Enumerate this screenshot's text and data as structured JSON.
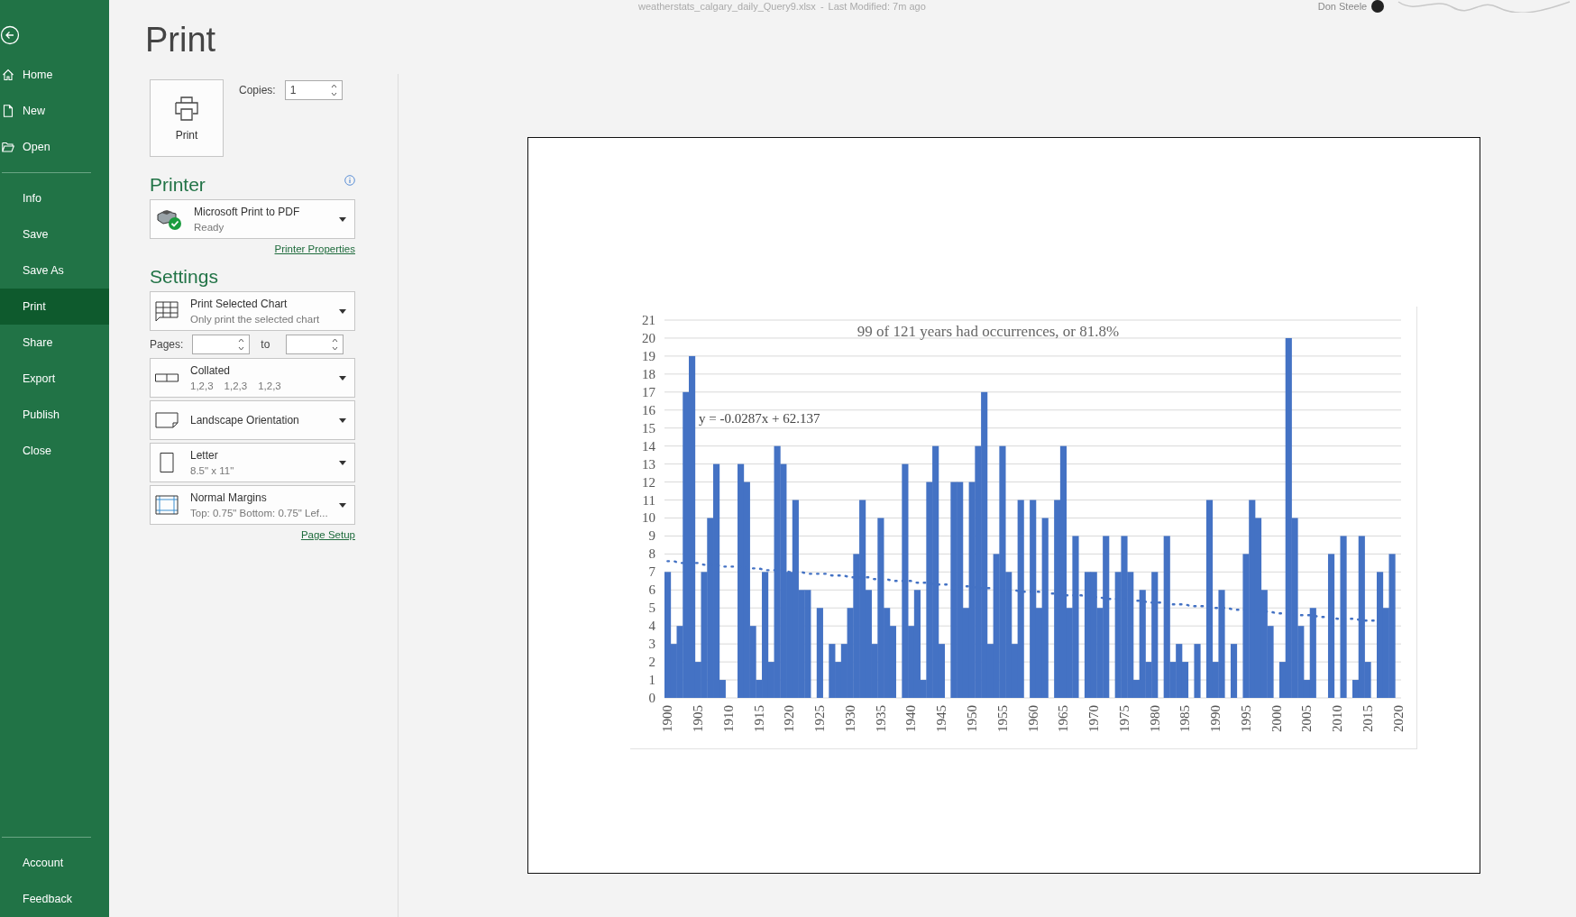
{
  "title_bar": {
    "file": "weatherstats_calgary_daily_Query9.xlsx",
    "separator": "-",
    "modified": "Last Modified: 7m ago",
    "user": "Don Steele"
  },
  "sidebar": {
    "top_items": [
      {
        "label": "Home",
        "kind": "home",
        "selected": false
      },
      {
        "label": "New",
        "kind": "new",
        "selected": false
      },
      {
        "label": "Open",
        "kind": "open",
        "selected": false
      }
    ],
    "items": [
      {
        "label": "Info",
        "selected": false
      },
      {
        "label": "Save",
        "selected": false
      },
      {
        "label": "Save As",
        "selected": false
      },
      {
        "label": "Print",
        "selected": true
      },
      {
        "label": "Share",
        "selected": false
      },
      {
        "label": "Export",
        "selected": false
      },
      {
        "label": "Publish",
        "selected": false
      },
      {
        "label": "Close",
        "selected": false
      }
    ],
    "bottom_items": [
      {
        "label": "Account",
        "selected": false
      },
      {
        "label": "Feedback",
        "selected": false
      }
    ]
  },
  "heading": "Print",
  "print_button": "Print",
  "copies": {
    "label": "Copies:",
    "value": "1"
  },
  "printer": {
    "heading": "Printer",
    "name": "Microsoft Print to PDF",
    "status": "Ready",
    "properties_link": "Printer Properties"
  },
  "settings": {
    "heading": "Settings",
    "scope": {
      "kind": "selection",
      "title": "Print Selected Chart",
      "subtitle": "Only print the selected chart"
    },
    "pages": {
      "label": "Pages:",
      "to_label": "to"
    },
    "options": [
      {
        "kind": "collate",
        "title": "Collated",
        "subtitle": [
          "1,2,3",
          "1,2,3",
          "1,2,3"
        ]
      },
      {
        "kind": "orientation",
        "title": "Landscape Orientation"
      },
      {
        "kind": "paper",
        "title": "Letter",
        "subtitle": [
          "8.5\" x 11\""
        ]
      },
      {
        "kind": "margins",
        "title": "Normal Margins",
        "subtitle": [
          "Top: 0.75\" Bottom: 0.75\" Lef..."
        ]
      }
    ],
    "page_setup_link": "Page Setup"
  },
  "preview": {
    "chart_data": {
      "type": "bar",
      "title": "99 of 121 years had occurrences, or 81.8%",
      "x": [
        1900,
        1901,
        1902,
        1903,
        1904,
        1905,
        1906,
        1907,
        1908,
        1909,
        1910,
        1911,
        1912,
        1913,
        1914,
        1915,
        1916,
        1917,
        1918,
        1919,
        1920,
        1921,
        1922,
        1923,
        1924,
        1925,
        1926,
        1927,
        1928,
        1929,
        1930,
        1931,
        1932,
        1933,
        1934,
        1935,
        1936,
        1937,
        1938,
        1939,
        1940,
        1941,
        1942,
        1943,
        1944,
        1945,
        1946,
        1947,
        1948,
        1949,
        1950,
        1951,
        1952,
        1953,
        1954,
        1955,
        1956,
        1957,
        1958,
        1959,
        1960,
        1961,
        1962,
        1963,
        1964,
        1965,
        1966,
        1967,
        1968,
        1969,
        1970,
        1971,
        1972,
        1973,
        1974,
        1975,
        1976,
        1977,
        1978,
        1979,
        1980,
        1981,
        1982,
        1983,
        1984,
        1985,
        1986,
        1987,
        1988,
        1989,
        1990,
        1991,
        1992,
        1993,
        1994,
        1995,
        1996,
        1997,
        1998,
        1999,
        2000,
        2001,
        2002,
        2003,
        2004,
        2005,
        2006,
        2007,
        2008,
        2009,
        2010,
        2011,
        2012,
        2013,
        2014,
        2015,
        2016,
        2017,
        2018,
        2019,
        2020
      ],
      "series": [
        {
          "color": "#4472c4",
          "values": [
            7,
            3,
            4,
            17,
            19,
            2,
            7,
            10,
            13,
            1,
            0,
            0,
            13,
            12,
            4,
            1,
            7,
            2,
            14,
            13,
            7,
            11,
            6,
            6,
            0,
            5,
            0,
            3,
            2,
            3,
            5,
            8,
            11,
            6,
            3,
            10,
            5,
            4,
            0,
            13,
            4,
            6,
            1,
            12,
            14,
            3,
            0,
            12,
            12,
            5,
            12,
            14,
            17,
            3,
            8,
            14,
            7,
            3,
            11,
            0,
            11,
            5,
            10,
            0,
            11,
            14,
            5,
            9,
            0,
            7,
            7,
            5,
            9,
            0,
            7,
            9,
            7,
            1,
            6,
            2,
            7,
            0,
            9,
            2,
            3,
            2,
            0,
            3,
            0,
            11,
            2,
            6,
            0,
            3,
            0,
            8,
            11,
            10,
            6,
            4,
            0,
            2,
            20,
            10,
            4,
            1,
            5,
            0,
            0,
            8,
            0,
            9,
            0,
            1,
            9,
            2,
            0,
            7,
            5,
            8,
            0
          ]
        },
        {
          "type": "line",
          "line_style": "dotted",
          "color": "#4472c4",
          "values": [
            7.6,
            7.6,
            7.5,
            7.5,
            7.5,
            7.5,
            7.4,
            7.4,
            7.4,
            7.3,
            7.3,
            7.3,
            7.3,
            7.2,
            7.2,
            7.2,
            7.1,
            7.1,
            7.1,
            7.1,
            7.0,
            7.0,
            7.0,
            6.9,
            6.9,
            6.9,
            6.9,
            6.8,
            6.8,
            6.8,
            6.7,
            6.7,
            6.7,
            6.7,
            6.6,
            6.6,
            6.6,
            6.5,
            6.5,
            6.5,
            6.5,
            6.4,
            6.4,
            6.4,
            6.3,
            6.3,
            6.3,
            6.3,
            6.2,
            6.2,
            6.2,
            6.1,
            6.1,
            6.1,
            6.1,
            6.0,
            6.0,
            6.0,
            5.9,
            5.9,
            5.9,
            5.9,
            5.8,
            5.8,
            5.8,
            5.7,
            5.7,
            5.7,
            5.7,
            5.6,
            5.6,
            5.6,
            5.5,
            5.5,
            5.5,
            5.5,
            5.4,
            5.4,
            5.4,
            5.3,
            5.3,
            5.3,
            5.3,
            5.2,
            5.2,
            5.2,
            5.1,
            5.1,
            5.1,
            5.0,
            5.0,
            5.0,
            5.0,
            4.9,
            4.9,
            4.9,
            4.8,
            4.8,
            4.8,
            4.8,
            4.7,
            4.7,
            4.7,
            4.6,
            4.6,
            4.6,
            4.6,
            4.5,
            4.5,
            4.5,
            4.4,
            4.4,
            4.4,
            4.4,
            4.3,
            4.3,
            4.3,
            null,
            null,
            null,
            null
          ]
        }
      ],
      "xlim": [
        1899.5,
        2020.5
      ],
      "grid": true,
      "ylim": [
        0,
        21
      ],
      "yticks": [
        0,
        1,
        2,
        3,
        4,
        5,
        6,
        7,
        8,
        9,
        10,
        11,
        12,
        13,
        14,
        15,
        16,
        17,
        18,
        19,
        20,
        21
      ],
      "xticks": [
        1900,
        1905,
        1910,
        1915,
        1920,
        1925,
        1930,
        1935,
        1940,
        1945,
        1950,
        1955,
        1960,
        1965,
        1970,
        1975,
        1980,
        1985,
        1990,
        1995,
        2000,
        2005,
        2010,
        2015,
        2020
      ],
      "annotations": [
        {
          "text": "y = -0.0287x + 62.137"
        }
      ]
    }
  }
}
